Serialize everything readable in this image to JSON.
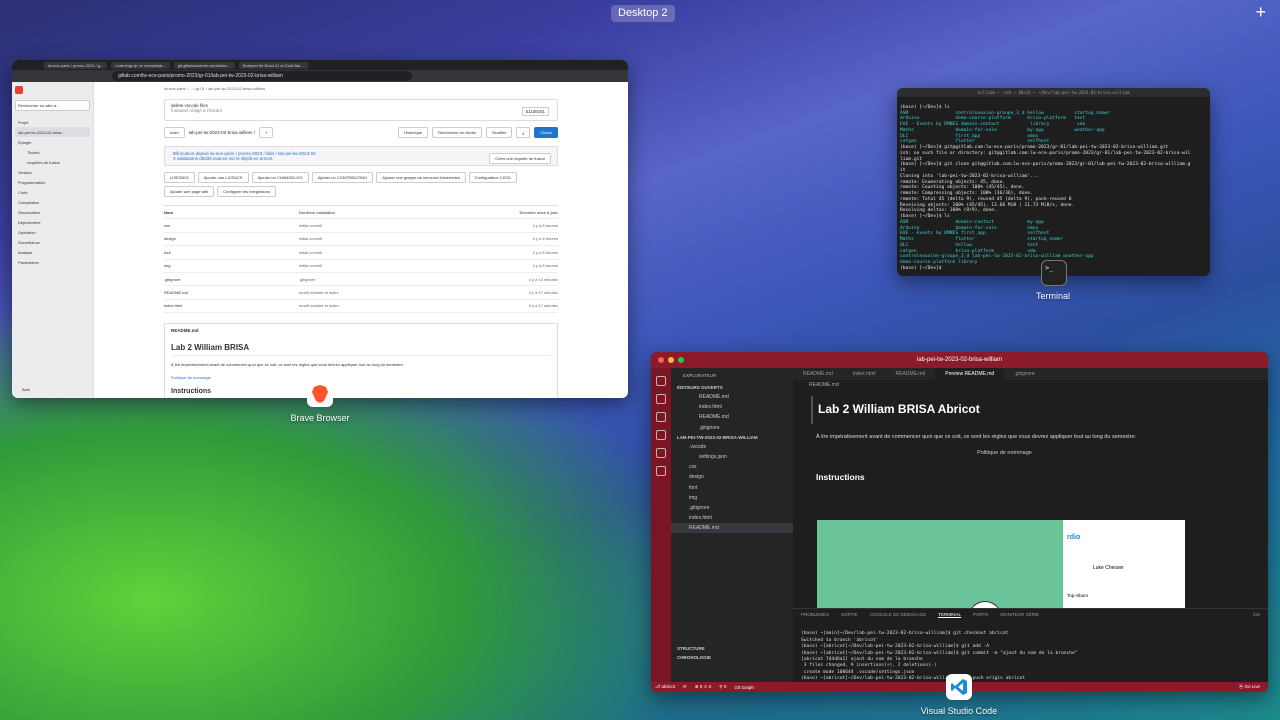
{
  "desktop": {
    "label": "Desktop 2",
    "add": "+"
  },
  "brave": {
    "app_label": "Brave Browser",
    "tabs": [
      "lw-ece-paris / promo-2023 / g...",
      "Learnings tp ne compristat...",
      "git.gitlabstudents.com/labex...",
      "Notepad for Brisa 21 et Gold Bar..."
    ],
    "url": "gitlab.com/lw-ece-paris/promo-2023/gr-01/lab-pei-tw-2023-02-brisa-william",
    "sidebar": {
      "project": "Projet",
      "repo_name": "lab-pei-tw-2023-02-brisa...",
      "search": "Rechercher ou aller à...",
      "items": [
        "Épingle",
        "Tickets",
        "requêtes de fusion",
        "Gestion",
        "Programmation",
        "Code",
        "Compilation",
        "Sécurisation",
        "Déploiement",
        "Opération",
        "Surveillance",
        "Analyse",
        "Paramètres"
      ],
      "help": "Aide"
    },
    "breadcrumb": "lw-ece-paris  /  ...  /  gr-01  /  lab-pei-tw-2023-02-brisa-william",
    "commit": {
      "title": "delete vscode files",
      "author": "funbasel rédigé à l'instant",
      "sha": "511d6c81"
    },
    "buttons": {
      "branch": "main",
      "path": "lab-pei-tw-2023-02-brisa-william  /",
      "plus": "+",
      "history": "Historique",
      "find": "Rechercher un fichier",
      "edit": "Modifier",
      "download": "⤓",
      "clone": "Cloner"
    },
    "fork": {
      "text": "Bifurcation depuis lw-ece-paris / promo-2023 / labs / lab-pei-tw-2023-02",
      "sub": "3 validations d8d38 avance sur le dépôt en amont.",
      "action": "Créer une requête de fusion"
    },
    "chips": [
      "LISEZMOI",
      "Ajouter une LICENCE",
      "Ajouter un CHANGELOG",
      "Ajouter un CONTRIBUTING",
      "Ajouter une grappe de serveurs Kubernetes",
      "Configuration CI/CD",
      "Ajouter une page wiki",
      "Configurer les intégrations"
    ],
    "table": {
      "headers": [
        "Nom",
        "Dernière validation",
        "Dernière mise à jour"
      ],
      "rows": [
        [
          "css",
          "initial commit",
          "il y a 8 heures"
        ],
        [
          "design",
          "initial commit",
          "il y a 8 heures"
        ],
        [
          "font",
          "initial commit",
          "il y a 8 heures"
        ],
        [
          "img",
          "initial commit",
          "il y a 8 heures"
        ],
        [
          ".gitignore",
          ".gitignore",
          "il y a 13 minutes"
        ],
        [
          "README.md",
          "modif readme et index",
          "il y a 17 minutes"
        ],
        [
          "index.html",
          "modif readme et index",
          "il y a 17 minutes"
        ]
      ]
    },
    "readme": {
      "file": "README.md",
      "title": "Lab 2 William BRISA",
      "intro": "À lire impérativement avant de commencer quoi que ce soit, ce sont les règles que vous devrez appliquer tout au long du semestre:",
      "link": "Politique de nommage",
      "h2": "Instructions"
    }
  },
  "terminal": {
    "app_label": "Terminal",
    "title": "william — -zsh — 80×24 — ~/Dev/lab-pei-tw-2023-02-brisa-william",
    "lines": [
      "(base) [~/Dev]$ ls",
      "ASM                 controleauxion-groupe_3_d hellow           startup_namer",
      "Arduino             demo-course-platform      krisa-platform   test",
      "EVE - Events by DMNES domain-contact           library          vda",
      "Maths               domain-for-sale           my-app           weather-app",
      "QLC                 first_app                 omnx",
      "catgen              flutter                   selfhost",
      "(base) [~/Dev]$ git@gitlab.com:lw-ece-paris/promo-2023/gr-01/lab-pei-tw-2023-02-brisa-william.git",
      "zsh: no such file or directory: git@gitlab.com:lw-ece-paris/promo-2023/gr-01/lab-pei-tw-2023-02-brisa-wil",
      "liam.git",
      "(base) [~/Dev]$ git clone git@gitlab.com:lw-ece-paris/promo-2023/gr-01/lab-pei-tw-2023-02-brisa-william.g",
      "it",
      "Cloning into 'lab-pei-tw-2023-02-brisa-william'...",
      "remote: Enumerating objects: 45, done.",
      "remote: Counting objects: 100% (45/45), done.",
      "remote: Compressing objects: 100% (36/36), done.",
      "remote: Total 45 (delta 9), reused 45 (delta 9), pack-reused 0",
      "Receiving objects: 100% (45/45), 13.66 MiB | 11.73 MiB/s, done.",
      "Resolving deltas: 100% (9/9), done.",
      "(base) [~/Dev]$ ls",
      "ASM                 domain-contact            my-app",
      "Arduino             domain-for-sale           omnx",
      "EVE - Events by DMNES first_app               selfhost",
      "Maths               flutter                   startup_namer",
      "QLC                 hellow                    test",
      "catgen              krisa-platform            vda",
      "controleauxion-groupe_3_d lab-pei-tw-2023-02-brisa-william weather-app",
      "demo-course-platform library",
      "(base) [~/Dev]$ "
    ]
  },
  "vscode": {
    "app_label": "Visual Studio Code",
    "title": "lab-pei-tw-2023-02-brisa-william",
    "explorer": {
      "header": "EXPLORATEUR",
      "open_editors": "ÉDITEURS OUVERTS",
      "open_files": [
        "README.md",
        "index.html",
        "README.md",
        ".gitignore"
      ],
      "root": "LAB-PEI-TW-2023-02-BRISA-WILLIAM",
      "tree": [
        ".vscode",
        "settings.json",
        "css",
        "design",
        "font",
        "img",
        ".gitignore",
        "index.html",
        "README.md"
      ],
      "outline": "STRUCTURE",
      "timeline": "CHRONOLOGIE"
    },
    "tabs": [
      "README.md",
      "index.html",
      "README.md",
      "Preview README.md",
      ".gitignore"
    ],
    "breadcrumb": "README.md",
    "preview": {
      "title": "Lab 2 William BRISA Abricot",
      "intro": "À lire impérativement avant de commencer quoi que ce soit, ce sont les règles que vous devrez appliquer tout au long du semestre:",
      "link": "Politique de nommage",
      "h2": "Instructions",
      "img_brand": "rdio",
      "img_user": "Luke Chesser",
      "img_section": "Top Album"
    },
    "panel_tabs": [
      "PROBLÈMES",
      "SORTIE",
      "CONSOLE DE DÉBOGAGE",
      "TERMINAL",
      "PORTS",
      "MONITEUR SÉRIE"
    ],
    "panel_shell": "zsh",
    "term_lines": [
      "(base) ~[main]~/Dev/lab-pei-tw-2023-02-brisa-william]$ git checkout abricot",
      "Switched to branch 'abricot'",
      "(base) ~[abricot]~/Dev/lab-pei-tw-2023-02-brisa-william]$ git add -A",
      "(base) ~[abricot]~/Dev/lab-pei-tw-2023-02-brisa-william]$ git commit -m \"ajout du nom de la branche\"",
      "[abricot 744d6a1] ajout du nom de la branche",
      " 3 files changed, 9 insertions(+), 2 deletions(-)",
      " create mode 100644 .vscode/settings.json",
      "(base) ~[abricot]~/Dev/lab-pei-tw-2023-02-brisa-william]$ git push origin abricot"
    ],
    "status": {
      "branch": "⎇ abricot",
      "sync": "⟳",
      "problems": "⊗ 0  ⚠ 0",
      "ports": "⚲ 0",
      "graph": "Git Graph",
      "live": "⦿ Go Live"
    }
  }
}
